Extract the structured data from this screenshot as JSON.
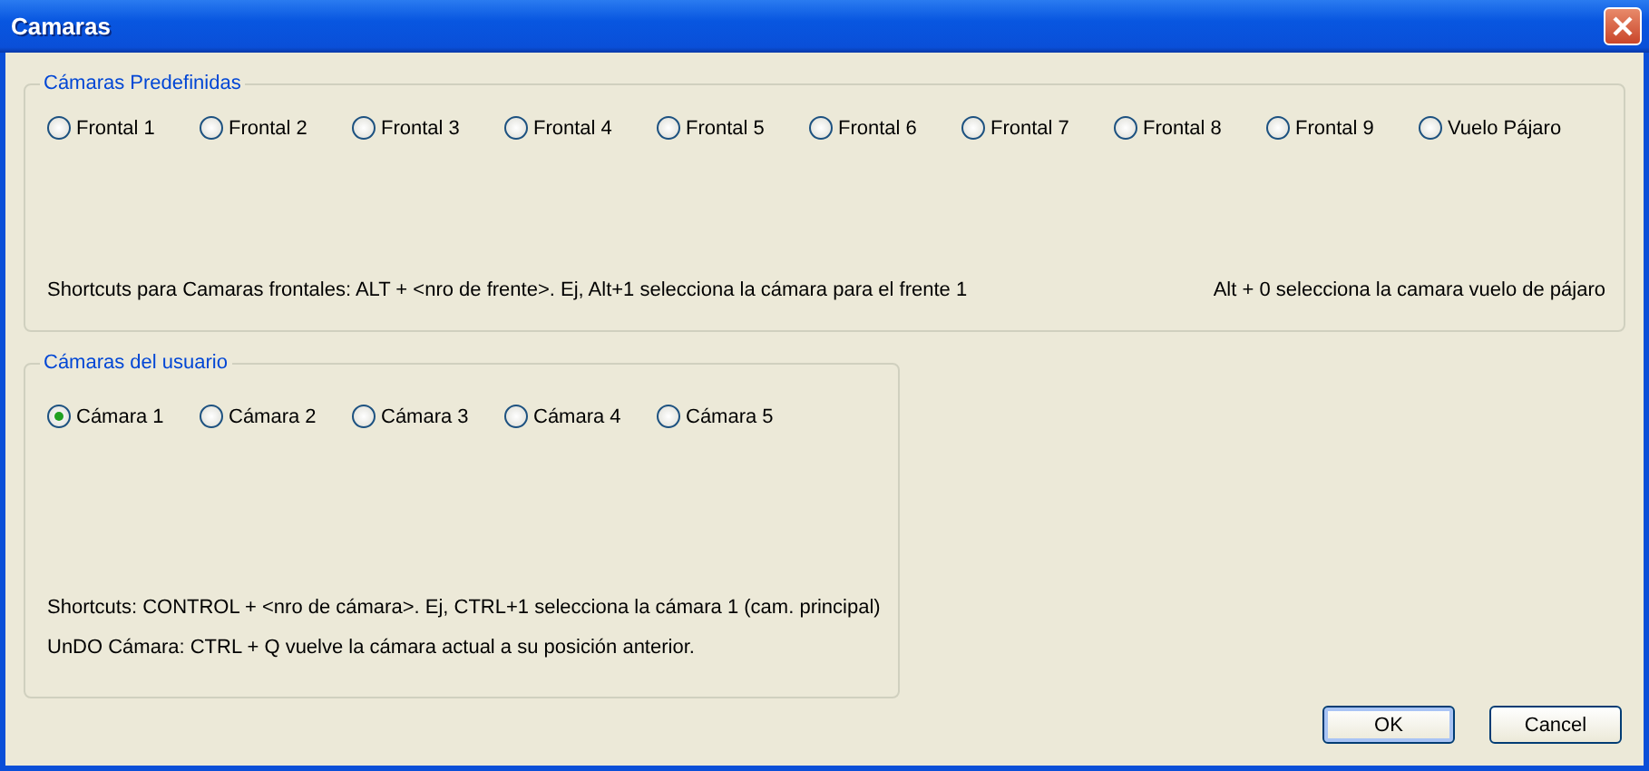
{
  "window": {
    "title": "Camaras"
  },
  "predefined_cameras": {
    "title": "Cámaras Predefinidas",
    "options": [
      {
        "label": "Frontal 1",
        "selected": false
      },
      {
        "label": "Frontal 2",
        "selected": false
      },
      {
        "label": "Frontal 3",
        "selected": false
      },
      {
        "label": "Frontal 4",
        "selected": false
      },
      {
        "label": "Frontal 5",
        "selected": false
      },
      {
        "label": "Frontal 6",
        "selected": false
      },
      {
        "label": "Frontal 7",
        "selected": false
      },
      {
        "label": "Frontal 8",
        "selected": false
      },
      {
        "label": "Frontal 9",
        "selected": false
      },
      {
        "label": "Vuelo Pájaro",
        "selected": false
      }
    ],
    "hint_left": "Shortcuts para Camaras frontales: ALT + <nro de frente>. Ej, Alt+1 selecciona la cámara para el frente 1",
    "hint_right": "Alt + 0 selecciona la camara vuelo de pájaro"
  },
  "user_cameras": {
    "title": "Cámaras del usuario",
    "options": [
      {
        "label": "Cámara 1",
        "selected": true
      },
      {
        "label": "Cámara 2",
        "selected": false
      },
      {
        "label": "Cámara 3",
        "selected": false
      },
      {
        "label": "Cámara 4",
        "selected": false
      },
      {
        "label": "Cámara 5",
        "selected": false
      }
    ],
    "hints": [
      "Shortcuts: CONTROL + <nro de cámara>. Ej, CTRL+1 selecciona la cámara 1 (cam. principal)",
      "UnDO Cámara: CTRL + Q vuelve la cámara actual a su posición anterior."
    ]
  },
  "buttons": [
    {
      "label": "OK",
      "default": true
    },
    {
      "label": "Cancel",
      "default": false
    }
  ]
}
